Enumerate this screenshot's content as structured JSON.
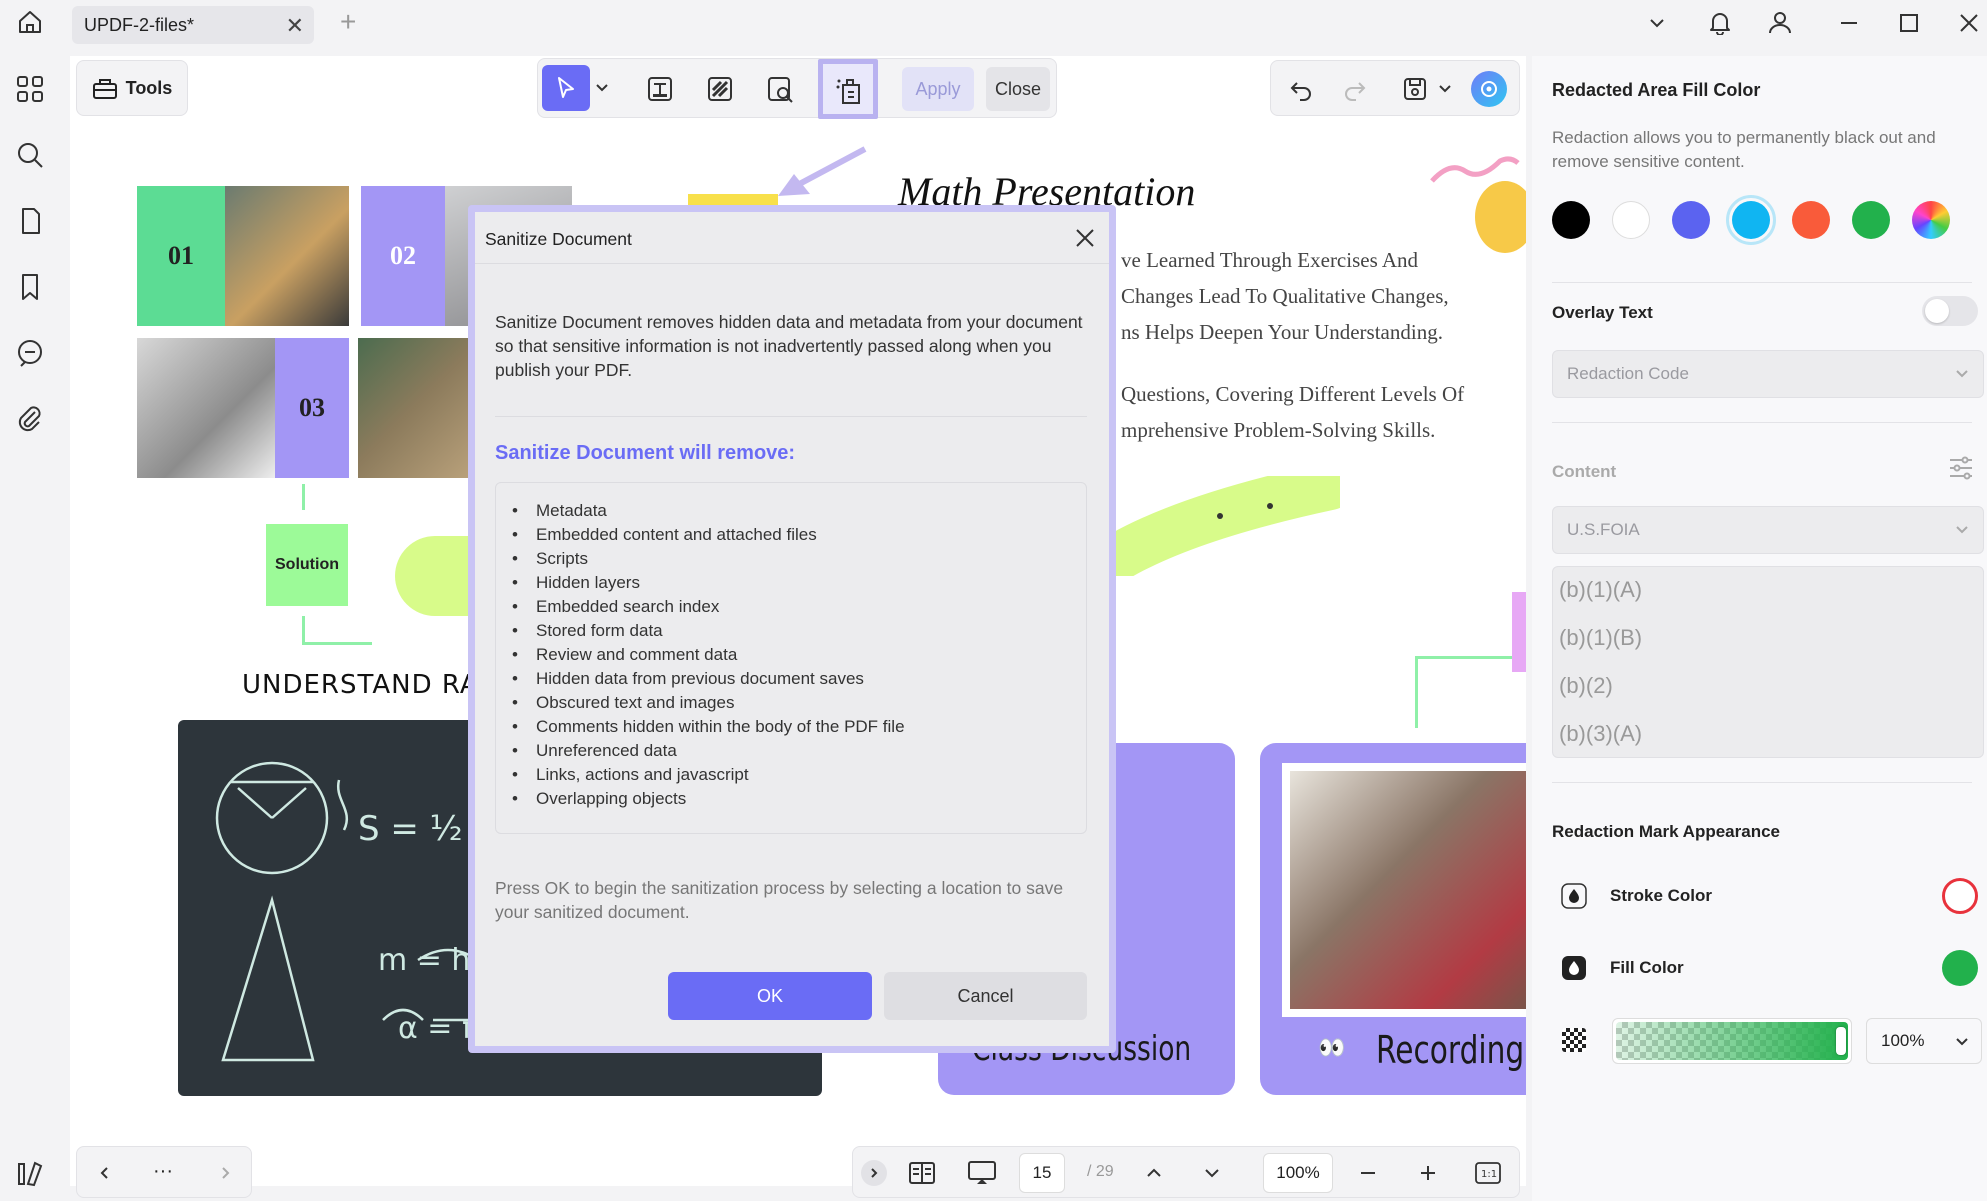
{
  "titlebar": {
    "tab_title": "UPDF-2-files*",
    "close_tab": "✕",
    "new_tab": "+"
  },
  "toolbar": {
    "tools_label": "Tools",
    "apply_label": "Apply",
    "close_label": "Close"
  },
  "page": {
    "title": "Math Presentation",
    "para1": [
      "ve Learned Through Exercises And",
      "Changes Lead To Qualitative Changes,",
      "ns Helps Deepen Your Understanding."
    ],
    "para2": [
      "Questions, Covering Different Levels Of",
      "mprehensive Problem-Solving Skills."
    ],
    "num_01": "01",
    "num_02": "02",
    "num_03": "03",
    "solution": "Solution",
    "understand": "UNDERSTAND RATH",
    "class_discussion": "Class Discussion",
    "recording": "Recording"
  },
  "dialog": {
    "title": "Sanitize Document",
    "intro": "Sanitize Document removes hidden data and metadata from your document so that sensitive information is not inadvertently passed along when you publish your PDF.",
    "heading": "Sanitize Document will remove:",
    "items": [
      "Metadata",
      "Embedded content and attached files",
      "Scripts",
      "Hidden layers",
      "Embedded search index",
      "Stored form data",
      "Review and comment data",
      "Hidden data from previous document saves",
      "Obscured text and images",
      "Comments hidden within the body of the PDF file",
      "Unreferenced data",
      "Links, actions and javascript",
      "Overlapping objects"
    ],
    "footer": "Press OK to begin the sanitization process by selecting a location to save your sanitized document.",
    "ok": "OK",
    "cancel": "Cancel"
  },
  "right_panel": {
    "fill_heading": "Redacted Area Fill Color",
    "fill_desc": "Redaction allows you to permanently black out and remove sensitive content.",
    "swatches": [
      "#000000",
      "#ffffff",
      "#5b63f0",
      "#10b5f2",
      "#f95b3a",
      "#22b14c",
      "rainbow"
    ],
    "overlay_text": "Overlay Text",
    "overlay_placeholder": "Redaction Code",
    "content_label": "Content",
    "content_select": "U.S.FOIA",
    "codes": [
      "(b)(1)(A)",
      "(b)(1)(B)",
      "(b)(2)",
      "(b)(3)(A)"
    ],
    "appearance_heading": "Redaction Mark Appearance",
    "stroke_label": "Stroke Color",
    "stroke_color": "#e8323c",
    "fill_label": "Fill Color",
    "fill_color": "#22b14c",
    "opacity": "100%",
    "opacity_fraction": 1.0
  },
  "bottom": {
    "more": "···",
    "page_current": "15",
    "page_total": "/ 29",
    "zoom": "100%"
  },
  "colors": {
    "accent": "#6a6cf5",
    "purple_block": "#a396f5",
    "green_block": "#5cdc94"
  }
}
